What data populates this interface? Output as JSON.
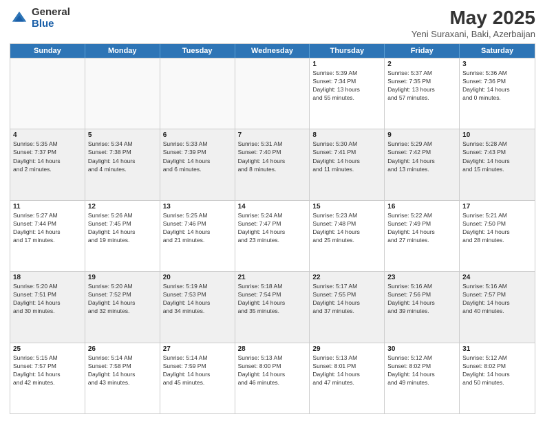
{
  "logo": {
    "general": "General",
    "blue": "Blue"
  },
  "header": {
    "title": "May 2025",
    "subtitle": "Yeni Suraxani, Baki, Azerbaijan"
  },
  "days": [
    "Sunday",
    "Monday",
    "Tuesday",
    "Wednesday",
    "Thursday",
    "Friday",
    "Saturday"
  ],
  "weeks": [
    [
      {
        "day": "",
        "lines": [],
        "empty": true
      },
      {
        "day": "",
        "lines": [],
        "empty": true
      },
      {
        "day": "",
        "lines": [],
        "empty": true
      },
      {
        "day": "",
        "lines": [],
        "empty": true
      },
      {
        "day": "1",
        "lines": [
          "Sunrise: 5:39 AM",
          "Sunset: 7:34 PM",
          "Daylight: 13 hours",
          "and 55 minutes."
        ]
      },
      {
        "day": "2",
        "lines": [
          "Sunrise: 5:37 AM",
          "Sunset: 7:35 PM",
          "Daylight: 13 hours",
          "and 57 minutes."
        ]
      },
      {
        "day": "3",
        "lines": [
          "Sunrise: 5:36 AM",
          "Sunset: 7:36 PM",
          "Daylight: 14 hours",
          "and 0 minutes."
        ]
      }
    ],
    [
      {
        "day": "4",
        "lines": [
          "Sunrise: 5:35 AM",
          "Sunset: 7:37 PM",
          "Daylight: 14 hours",
          "and 2 minutes."
        ],
        "shaded": true
      },
      {
        "day": "5",
        "lines": [
          "Sunrise: 5:34 AM",
          "Sunset: 7:38 PM",
          "Daylight: 14 hours",
          "and 4 minutes."
        ],
        "shaded": true
      },
      {
        "day": "6",
        "lines": [
          "Sunrise: 5:33 AM",
          "Sunset: 7:39 PM",
          "Daylight: 14 hours",
          "and 6 minutes."
        ],
        "shaded": true
      },
      {
        "day": "7",
        "lines": [
          "Sunrise: 5:31 AM",
          "Sunset: 7:40 PM",
          "Daylight: 14 hours",
          "and 8 minutes."
        ],
        "shaded": true
      },
      {
        "day": "8",
        "lines": [
          "Sunrise: 5:30 AM",
          "Sunset: 7:41 PM",
          "Daylight: 14 hours",
          "and 11 minutes."
        ],
        "shaded": true
      },
      {
        "day": "9",
        "lines": [
          "Sunrise: 5:29 AM",
          "Sunset: 7:42 PM",
          "Daylight: 14 hours",
          "and 13 minutes."
        ],
        "shaded": true
      },
      {
        "day": "10",
        "lines": [
          "Sunrise: 5:28 AM",
          "Sunset: 7:43 PM",
          "Daylight: 14 hours",
          "and 15 minutes."
        ],
        "shaded": true
      }
    ],
    [
      {
        "day": "11",
        "lines": [
          "Sunrise: 5:27 AM",
          "Sunset: 7:44 PM",
          "Daylight: 14 hours",
          "and 17 minutes."
        ]
      },
      {
        "day": "12",
        "lines": [
          "Sunrise: 5:26 AM",
          "Sunset: 7:45 PM",
          "Daylight: 14 hours",
          "and 19 minutes."
        ]
      },
      {
        "day": "13",
        "lines": [
          "Sunrise: 5:25 AM",
          "Sunset: 7:46 PM",
          "Daylight: 14 hours",
          "and 21 minutes."
        ]
      },
      {
        "day": "14",
        "lines": [
          "Sunrise: 5:24 AM",
          "Sunset: 7:47 PM",
          "Daylight: 14 hours",
          "and 23 minutes."
        ]
      },
      {
        "day": "15",
        "lines": [
          "Sunrise: 5:23 AM",
          "Sunset: 7:48 PM",
          "Daylight: 14 hours",
          "and 25 minutes."
        ]
      },
      {
        "day": "16",
        "lines": [
          "Sunrise: 5:22 AM",
          "Sunset: 7:49 PM",
          "Daylight: 14 hours",
          "and 27 minutes."
        ]
      },
      {
        "day": "17",
        "lines": [
          "Sunrise: 5:21 AM",
          "Sunset: 7:50 PM",
          "Daylight: 14 hours",
          "and 28 minutes."
        ]
      }
    ],
    [
      {
        "day": "18",
        "lines": [
          "Sunrise: 5:20 AM",
          "Sunset: 7:51 PM",
          "Daylight: 14 hours",
          "and 30 minutes."
        ],
        "shaded": true
      },
      {
        "day": "19",
        "lines": [
          "Sunrise: 5:20 AM",
          "Sunset: 7:52 PM",
          "Daylight: 14 hours",
          "and 32 minutes."
        ],
        "shaded": true
      },
      {
        "day": "20",
        "lines": [
          "Sunrise: 5:19 AM",
          "Sunset: 7:53 PM",
          "Daylight: 14 hours",
          "and 34 minutes."
        ],
        "shaded": true
      },
      {
        "day": "21",
        "lines": [
          "Sunrise: 5:18 AM",
          "Sunset: 7:54 PM",
          "Daylight: 14 hours",
          "and 35 minutes."
        ],
        "shaded": true
      },
      {
        "day": "22",
        "lines": [
          "Sunrise: 5:17 AM",
          "Sunset: 7:55 PM",
          "Daylight: 14 hours",
          "and 37 minutes."
        ],
        "shaded": true
      },
      {
        "day": "23",
        "lines": [
          "Sunrise: 5:16 AM",
          "Sunset: 7:56 PM",
          "Daylight: 14 hours",
          "and 39 minutes."
        ],
        "shaded": true
      },
      {
        "day": "24",
        "lines": [
          "Sunrise: 5:16 AM",
          "Sunset: 7:57 PM",
          "Daylight: 14 hours",
          "and 40 minutes."
        ],
        "shaded": true
      }
    ],
    [
      {
        "day": "25",
        "lines": [
          "Sunrise: 5:15 AM",
          "Sunset: 7:57 PM",
          "Daylight: 14 hours",
          "and 42 minutes."
        ]
      },
      {
        "day": "26",
        "lines": [
          "Sunrise: 5:14 AM",
          "Sunset: 7:58 PM",
          "Daylight: 14 hours",
          "and 43 minutes."
        ]
      },
      {
        "day": "27",
        "lines": [
          "Sunrise: 5:14 AM",
          "Sunset: 7:59 PM",
          "Daylight: 14 hours",
          "and 45 minutes."
        ]
      },
      {
        "day": "28",
        "lines": [
          "Sunrise: 5:13 AM",
          "Sunset: 8:00 PM",
          "Daylight: 14 hours",
          "and 46 minutes."
        ]
      },
      {
        "day": "29",
        "lines": [
          "Sunrise: 5:13 AM",
          "Sunset: 8:01 PM",
          "Daylight: 14 hours",
          "and 47 minutes."
        ]
      },
      {
        "day": "30",
        "lines": [
          "Sunrise: 5:12 AM",
          "Sunset: 8:02 PM",
          "Daylight: 14 hours",
          "and 49 minutes."
        ]
      },
      {
        "day": "31",
        "lines": [
          "Sunrise: 5:12 AM",
          "Sunset: 8:02 PM",
          "Daylight: 14 hours",
          "and 50 minutes."
        ]
      }
    ]
  ]
}
